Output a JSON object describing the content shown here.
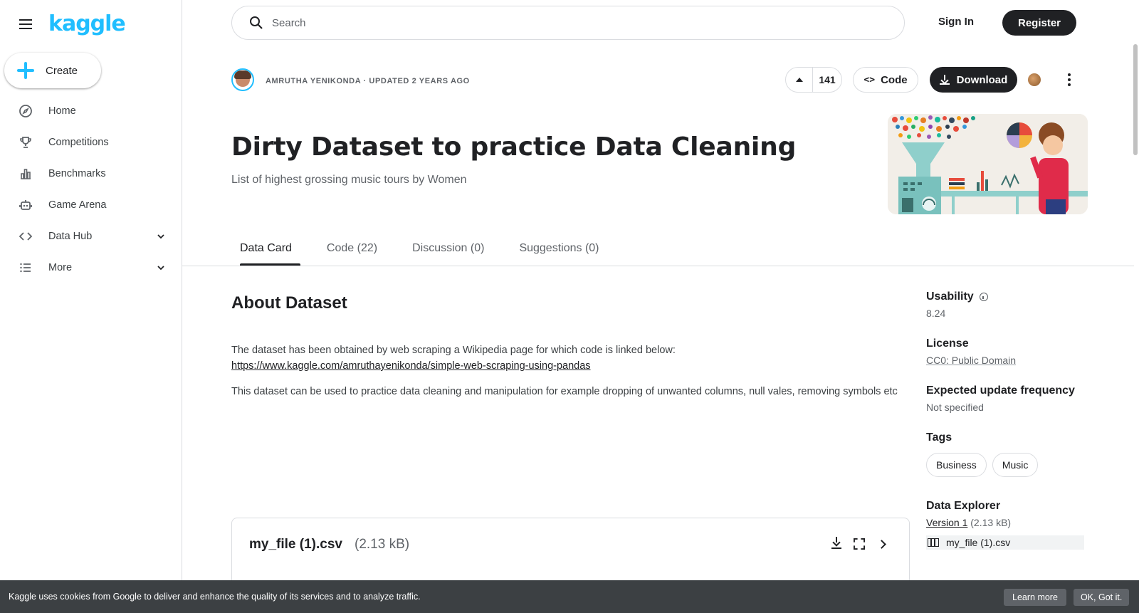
{
  "brand": {
    "logo_text": "kaggle",
    "accent": "#20beff"
  },
  "sidebar": {
    "create_label": "Create",
    "items": [
      {
        "label": "Home",
        "icon": "compass-icon"
      },
      {
        "label": "Competitions",
        "icon": "trophy-icon"
      },
      {
        "label": "Benchmarks",
        "icon": "bar-chart-icon"
      },
      {
        "label": "Game Arena",
        "icon": "robot-icon"
      },
      {
        "label": "Data Hub",
        "icon": "code-brackets-icon",
        "expandable": true
      },
      {
        "label": "More",
        "icon": "list-icon",
        "expandable": true
      }
    ]
  },
  "header": {
    "search_placeholder": "Search",
    "signin_label": "Sign In",
    "register_label": "Register"
  },
  "dataset": {
    "author_line": "AMRUTHA YENIKONDA · UPDATED 2 YEARS AGO",
    "vote_count": "141",
    "code_label": "Code",
    "download_label": "Download",
    "title": "Dirty Dataset to practice Data Cleaning",
    "subtitle": "List of highest grossing music tours by Women"
  },
  "tabs": [
    {
      "label": "Data Card",
      "active": true
    },
    {
      "label": "Code (22)",
      "active": false
    },
    {
      "label": "Discussion (0)",
      "active": false
    },
    {
      "label": "Suggestions (0)",
      "active": false
    }
  ],
  "about": {
    "heading": "About Dataset",
    "para1": "The dataset has been obtained by web scraping a Wikipedia page for which code is linked below:",
    "link": "https://www.kaggle.com/amruthayenikonda/simple-web-scraping-using-pandas",
    "para2": "This dataset can be used to practice data cleaning and manipulation for example dropping of unwanted columns, null vales, removing symbols etc"
  },
  "file_card": {
    "name": "my_file (1).csv",
    "size": "(2.13 kB)"
  },
  "meta": {
    "usability_label": "Usability",
    "usability_value": "8.24",
    "license_label": "License",
    "license_value": "CC0: Public Domain",
    "frequency_label": "Expected update frequency",
    "frequency_value": "Not specified",
    "tags_label": "Tags",
    "tags": [
      "Business",
      "Music"
    ],
    "explorer_label": "Data Explorer",
    "version_link": "Version 1",
    "version_size": "(2.13 kB)",
    "explorer_file": "my_file (1).csv"
  },
  "cookie": {
    "text": "Kaggle uses cookies from Google to deliver and enhance the quality of its services and to analyze traffic.",
    "learn_label": "Learn more",
    "ok_label": "OK, Got it."
  }
}
